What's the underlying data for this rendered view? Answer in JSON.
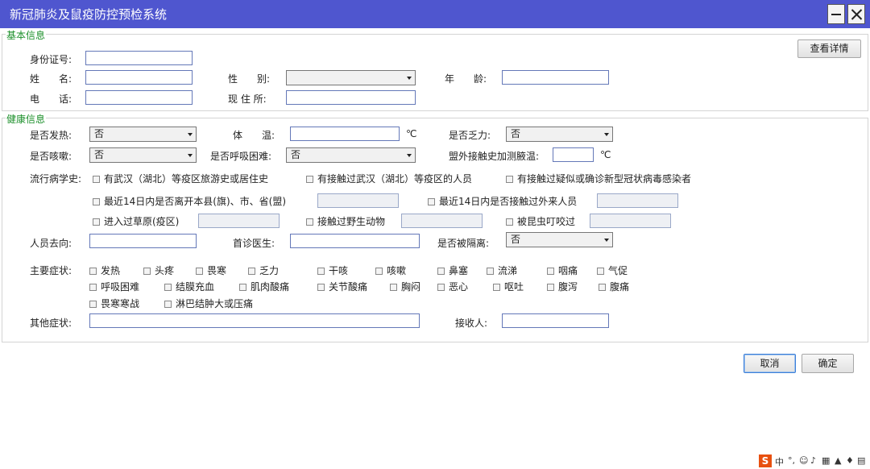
{
  "window": {
    "title": "新冠肺炎及鼠疫防控预检系统"
  },
  "basic": {
    "title": "基本信息",
    "id_label": "身份证号:",
    "name_label": "姓　　名:",
    "gender_label": "性　　别:",
    "age_label": "年　　龄:",
    "phone_label": "电　　话:",
    "address_label": "现 住 所:",
    "details_button": "查看详情"
  },
  "health": {
    "title": "健康信息",
    "fever_label": "是否发热:",
    "fever_value": "否",
    "temp_label": "体　　温:",
    "temp_unit": "℃",
    "fatigue_label": "是否乏力:",
    "fatigue_value": "否",
    "cough_label": "是否咳嗽:",
    "cough_value": "否",
    "breath_label": "是否呼吸困难:",
    "breath_value": "否",
    "outside_temp_label": "盟外接触史加测腋温:",
    "outside_temp_unit": "℃",
    "epi_label": "流行病学史:",
    "epi": [
      "有武汉（湖北）等疫区旅游史或居住史",
      "有接触过武汉（湖北）等疫区的人员",
      "有接触过疑似或确诊新型冠状病毒感染者",
      "最近14日内是否离开本县(旗)、市、省(盟)",
      "最近14日内是否接触过外来人员",
      "进入过草原(疫区)",
      "接触过野生动物",
      "被昆虫叮咬过"
    ],
    "destination_label": "人员去向:",
    "doctor_label": "首诊医生:",
    "isolated_label": "是否被隔离:",
    "isolated_value": "否",
    "symptoms_label": "主要症状:",
    "symptoms": [
      "发热",
      "头疼",
      "畏寒",
      "乏力",
      "干咳",
      "咳嗽",
      "鼻塞",
      "流涕",
      "咽痛",
      "气促",
      "呼吸困难",
      "结膜充血",
      "肌肉酸痛",
      "关节酸痛",
      "胸闷",
      "恶心",
      "呕吐",
      "腹泻",
      "腹痛",
      "畏寒寒战",
      "淋巴结肿大或压痛"
    ],
    "other_label": "其他症状:",
    "receiver_label": "接收人:"
  },
  "actions": {
    "cancel": "取消",
    "ok": "确定"
  },
  "tray": {
    "ime_logo": "S",
    "ime_mode": "中"
  }
}
